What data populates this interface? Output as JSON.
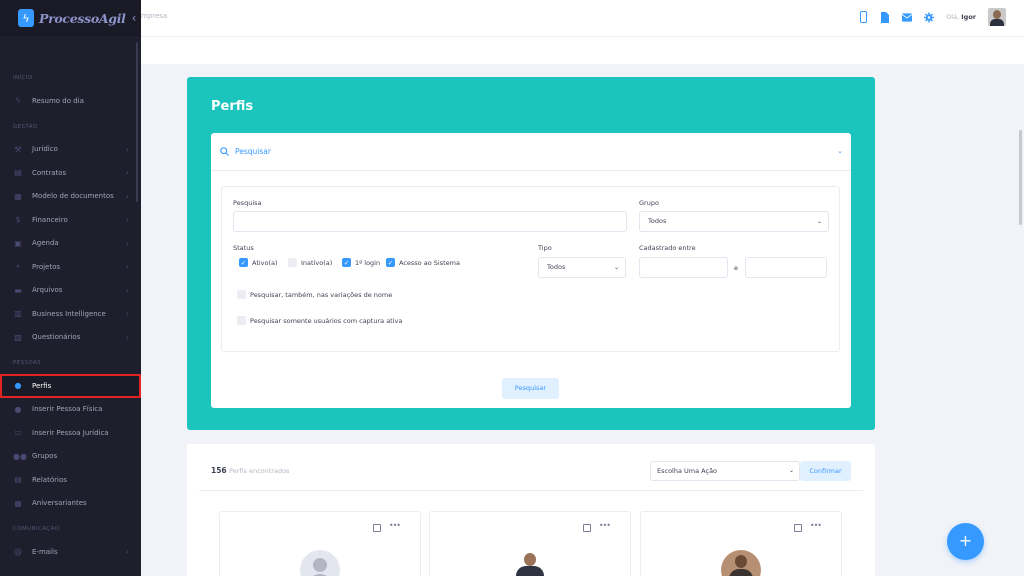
{
  "app": {
    "name": "ProcessoAgil"
  },
  "topbar": {
    "breadcrumb": "mpresa",
    "greeting": "Olá,",
    "user": "Igor"
  },
  "sidebar": {
    "sections": [
      {
        "title": "INÍCIO",
        "items": [
          {
            "label": "Resumo do dia",
            "icon": "bolt-icon"
          }
        ]
      },
      {
        "title": "GESTÃO",
        "items": [
          {
            "label": "Jurídico",
            "icon": "gavel-icon",
            "chevron": true
          },
          {
            "label": "Contratos",
            "icon": "document-icon",
            "chevron": true
          },
          {
            "label": "Modelo de documentos",
            "icon": "file-icon",
            "chevron": true
          },
          {
            "label": "Financeiro",
            "icon": "dollar-icon",
            "chevron": true
          },
          {
            "label": "Agenda",
            "icon": "calendar-icon",
            "chevron": true
          },
          {
            "label": "Projetos",
            "icon": "sitemap-icon",
            "chevron": true
          },
          {
            "label": "Arquivos",
            "icon": "folder-icon",
            "chevron": true
          },
          {
            "label": "Business Intelligence",
            "icon": "chart-icon",
            "chevron": true
          },
          {
            "label": "Questionários",
            "icon": "clipboard-icon",
            "chevron": true
          }
        ]
      },
      {
        "title": "PESSOAS",
        "items": [
          {
            "label": "Perfis",
            "icon": "user-icon",
            "active": true
          },
          {
            "label": "Inserir Pessoa Física",
            "icon": "user-plus-icon"
          },
          {
            "label": "Inserir Pessoa Jurídica",
            "icon": "briefcase-icon"
          },
          {
            "label": "Grupos",
            "icon": "users-icon"
          },
          {
            "label": "Relatórios",
            "icon": "report-icon"
          },
          {
            "label": "Aniversariantes",
            "icon": "gift-icon"
          }
        ]
      },
      {
        "title": "COMUNICAÇÃO",
        "items": [
          {
            "label": "E-mails",
            "icon": "at-icon",
            "chevron": true
          }
        ]
      }
    ]
  },
  "profiles": {
    "title": "Perfis",
    "search_toggle": "Pesquisar",
    "fields": {
      "search_label": "Pesquisa",
      "group_label": "Grupo",
      "group_value": "Todos",
      "status_label": "Status",
      "status_options": [
        {
          "label": "Ativo(a)",
          "checked": true
        },
        {
          "label": "Inativo(a)",
          "checked": false
        },
        {
          "label": "1º login",
          "checked": true
        },
        {
          "label": "Acesso ao Sistema",
          "checked": true
        }
      ],
      "type_label": "Tipo",
      "type_value": "Todos",
      "registered_label": "Cadastrado entre",
      "and_label": "e",
      "name_variations": "Pesquisar, também, nas variações de nome",
      "active_capture": "Pesquisar somente usuários com captura ativa"
    },
    "search_button": "Pesquisar"
  },
  "results": {
    "count": "156",
    "count_label": "Perfis encontrados",
    "action_placeholder": "Escolha Uma Ação",
    "confirm_button": "Confirmar",
    "dots": "•••",
    "fab": "+"
  }
}
